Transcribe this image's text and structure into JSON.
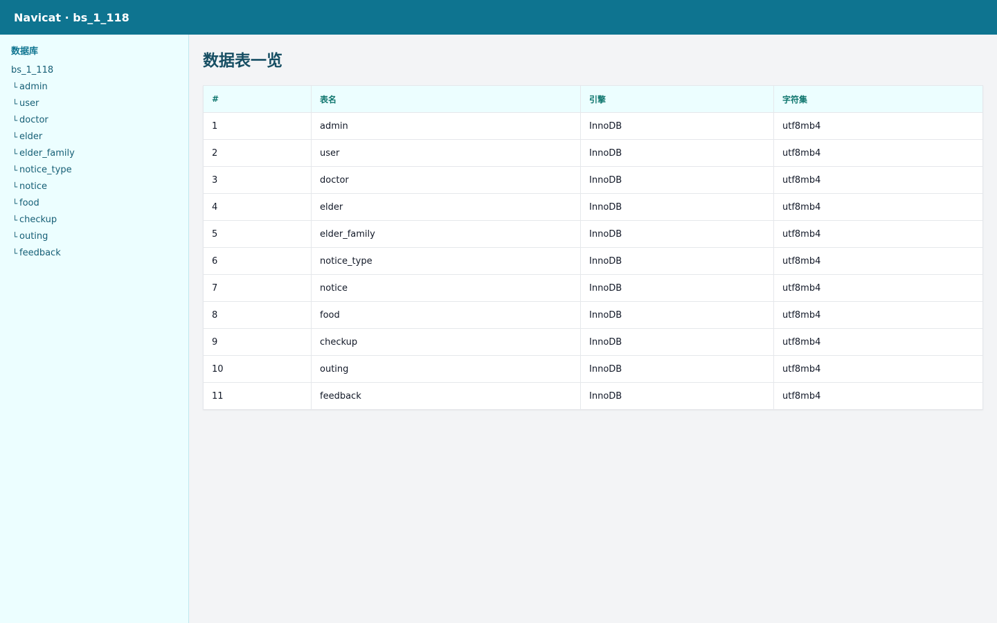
{
  "window": {
    "title": "Navicat · bs_1_118"
  },
  "sidebar": {
    "section_title": "数据库",
    "database": "bs_1_118",
    "branch_glyph": "└",
    "tables": [
      "admin",
      "user",
      "doctor",
      "elder",
      "elder_family",
      "notice_type",
      "notice",
      "food",
      "checkup",
      "outing",
      "feedback"
    ]
  },
  "main": {
    "title": "数据表一览",
    "columns": [
      "#",
      "表名",
      "引擎",
      "字符集"
    ],
    "rows": [
      [
        "1",
        "admin",
        "InnoDB",
        "utf8mb4"
      ],
      [
        "2",
        "user",
        "InnoDB",
        "utf8mb4"
      ],
      [
        "3",
        "doctor",
        "InnoDB",
        "utf8mb4"
      ],
      [
        "4",
        "elder",
        "InnoDB",
        "utf8mb4"
      ],
      [
        "5",
        "elder_family",
        "InnoDB",
        "utf8mb4"
      ],
      [
        "6",
        "notice_type",
        "InnoDB",
        "utf8mb4"
      ],
      [
        "7",
        "notice",
        "InnoDB",
        "utf8mb4"
      ],
      [
        "8",
        "food",
        "InnoDB",
        "utf8mb4"
      ],
      [
        "9",
        "checkup",
        "InnoDB",
        "utf8mb4"
      ],
      [
        "10",
        "outing",
        "InnoDB",
        "utf8mb4"
      ],
      [
        "11",
        "feedback",
        "InnoDB",
        "utf8mb4"
      ]
    ]
  },
  "colors": {
    "topbar": "#0e7490",
    "sidebar_bg": "#ecfeff",
    "header_text": "#0f766e",
    "title_text": "#164e63"
  }
}
